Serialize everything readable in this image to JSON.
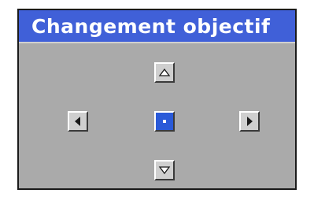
{
  "window": {
    "title": "Changement objectif"
  },
  "lens_shift": {
    "buttons": [
      {
        "id": "up",
        "icon": "triangle-up-icon"
      },
      {
        "id": "left",
        "icon": "triangle-left-icon"
      },
      {
        "id": "center",
        "icon": "center-dot-icon",
        "selected": true
      },
      {
        "id": "right",
        "icon": "triangle-right-icon"
      },
      {
        "id": "down",
        "icon": "triangle-down-icon"
      }
    ]
  },
  "colors": {
    "title_bar": "#4060d8",
    "panel_background": "#aaaaaa",
    "button_face": "#cfcfcf",
    "selected_button": "#2a5ad8"
  }
}
